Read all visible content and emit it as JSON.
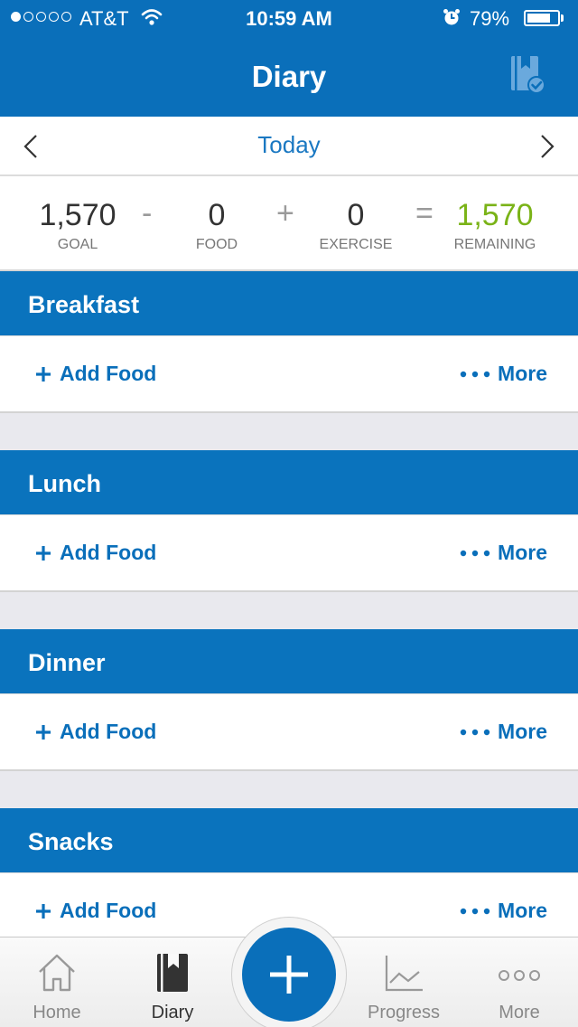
{
  "status_bar": {
    "carrier": "AT&T",
    "time": "10:59 AM",
    "battery": "79%",
    "battery_level": 0.79
  },
  "nav": {
    "title": "Diary"
  },
  "date": {
    "label": "Today"
  },
  "summary": {
    "goal": {
      "value": "1,570",
      "label": "GOAL"
    },
    "minus": "-",
    "food": {
      "value": "0",
      "label": "FOOD"
    },
    "plus": "+",
    "exercise": {
      "value": "0",
      "label": "EXERCISE"
    },
    "equals": "=",
    "remaining": {
      "value": "1,570",
      "label": "REMAINING"
    }
  },
  "meals": [
    {
      "name": "Breakfast",
      "add_label": "Add Food",
      "more_label": "More"
    },
    {
      "name": "Lunch",
      "add_label": "Add Food",
      "more_label": "More"
    },
    {
      "name": "Dinner",
      "add_label": "Add Food",
      "more_label": "More"
    },
    {
      "name": "Snacks",
      "add_label": "Add Food",
      "more_label": "More"
    }
  ],
  "tabs": [
    {
      "label": "Home",
      "icon": "home-icon"
    },
    {
      "label": "Diary",
      "icon": "diary-icon",
      "active": true
    },
    {
      "label": "Progress",
      "icon": "chart-icon"
    },
    {
      "label": "More",
      "icon": "more-dots-icon"
    }
  ],
  "colors": {
    "primary": "#0a6fba",
    "remaining_green": "#7ab317"
  }
}
